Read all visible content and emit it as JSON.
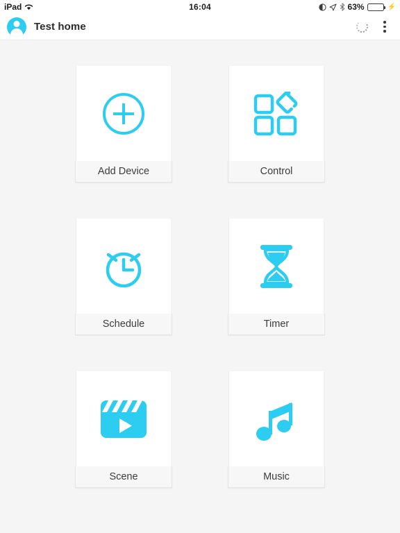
{
  "statusbar": {
    "device_label": "iPad",
    "wifi_icon": "wifi-icon",
    "time": "16:04",
    "right_icons": [
      "alarm-icon",
      "location-arrow-icon",
      "bluetooth-icon"
    ],
    "battery_percent": "63%",
    "battery_level": 63,
    "charging_icon": "lightning-bolt-icon",
    "battery_fill_color": "#4cd764"
  },
  "navbar": {
    "avatar_icon": "user-avatar-icon",
    "title": "Test home",
    "spinner_icon": "loading-spinner-icon",
    "menu_icon": "overflow-menu-icon"
  },
  "theme": {
    "accent": "#2ccdf0",
    "page_background": "#f5f5f5",
    "card_background": "#ffffff",
    "label_background": "#f7f7f7"
  },
  "grid": {
    "tiles": [
      {
        "label": "Add Device",
        "icon": "add-device-plus-circle-icon"
      },
      {
        "label": "Control",
        "icon": "control-blocks-icon"
      },
      {
        "label": "Schedule",
        "icon": "alarm-clock-icon"
      },
      {
        "label": "Timer",
        "icon": "hourglass-icon"
      },
      {
        "label": "Scene",
        "icon": "clapperboard-play-icon"
      },
      {
        "label": "Music",
        "icon": "music-note-icon"
      }
    ]
  }
}
